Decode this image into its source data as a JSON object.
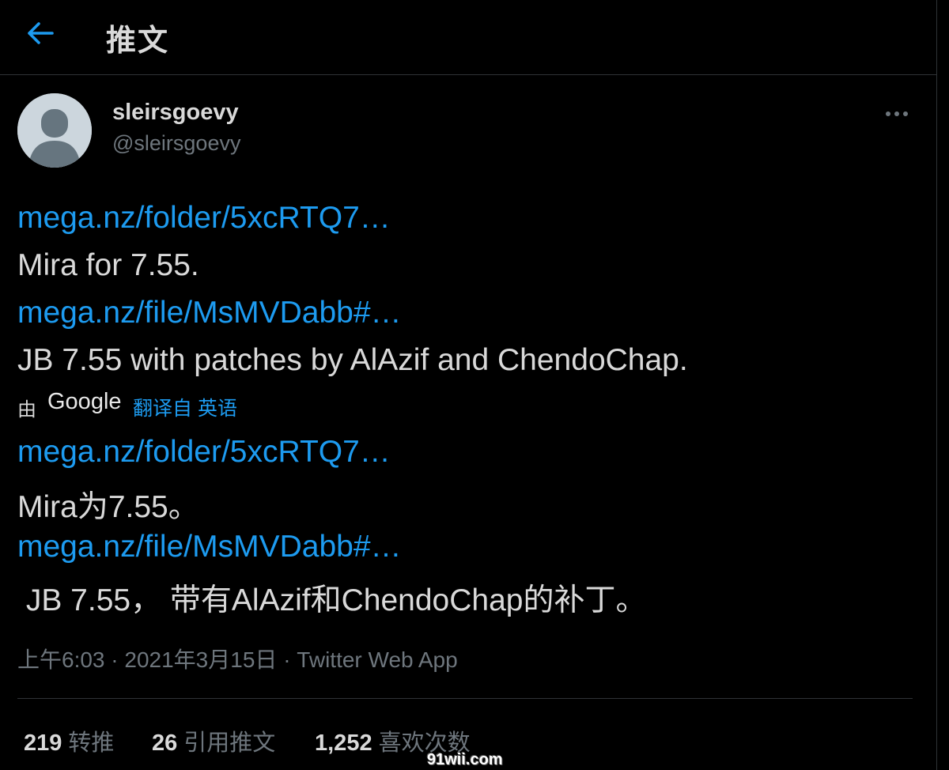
{
  "header": {
    "title": "推文"
  },
  "tweet": {
    "display_name": "sleirsgoevy",
    "handle": "@sleirsgoevy",
    "lines": [
      {
        "text": "mega.nz/folder/5xcRTQ7…",
        "link": true
      },
      {
        "text": "Mira for 7.55.",
        "link": false
      },
      {
        "text": "mega.nz/file/MsMVDabb#…",
        "link": true
      },
      {
        "text": "JB 7.55 with patches by AlAzif and ChendoChap.",
        "link": false
      }
    ],
    "translation": {
      "by_label": "由",
      "provider": "Google",
      "from_label": "翻译自 英语"
    },
    "translated_lines": [
      {
        "text": "mega.nz/folder/5xcRTQ7…",
        "link": true
      },
      {
        "text": "Mira为7.55。",
        "link": false
      },
      {
        "text": "mega.nz/file/MsMVDabb#…",
        "link": true
      },
      {
        "text": " JB 7.55， 带有AlAzif和ChendoChap的补丁。",
        "link": false
      }
    ],
    "time": "上午6:03",
    "date": "2021年3月15日",
    "separator": "·",
    "source": "Twitter Web App"
  },
  "stats": {
    "retweets": {
      "num": "219",
      "label": "转推"
    },
    "quotes": {
      "num": "26",
      "label": "引用推文"
    },
    "likes": {
      "num": "1,252",
      "label": "喜欢次数"
    }
  },
  "watermark": "91wii.com",
  "colors": {
    "link": "#1d9bf0",
    "text": "#d9d9d9",
    "muted": "#6e767d",
    "border": "#2f3336",
    "background": "#000000"
  },
  "icons": {
    "back": "arrow-left-icon",
    "more": "more-dots-icon",
    "avatar": "default-avatar-icon"
  }
}
